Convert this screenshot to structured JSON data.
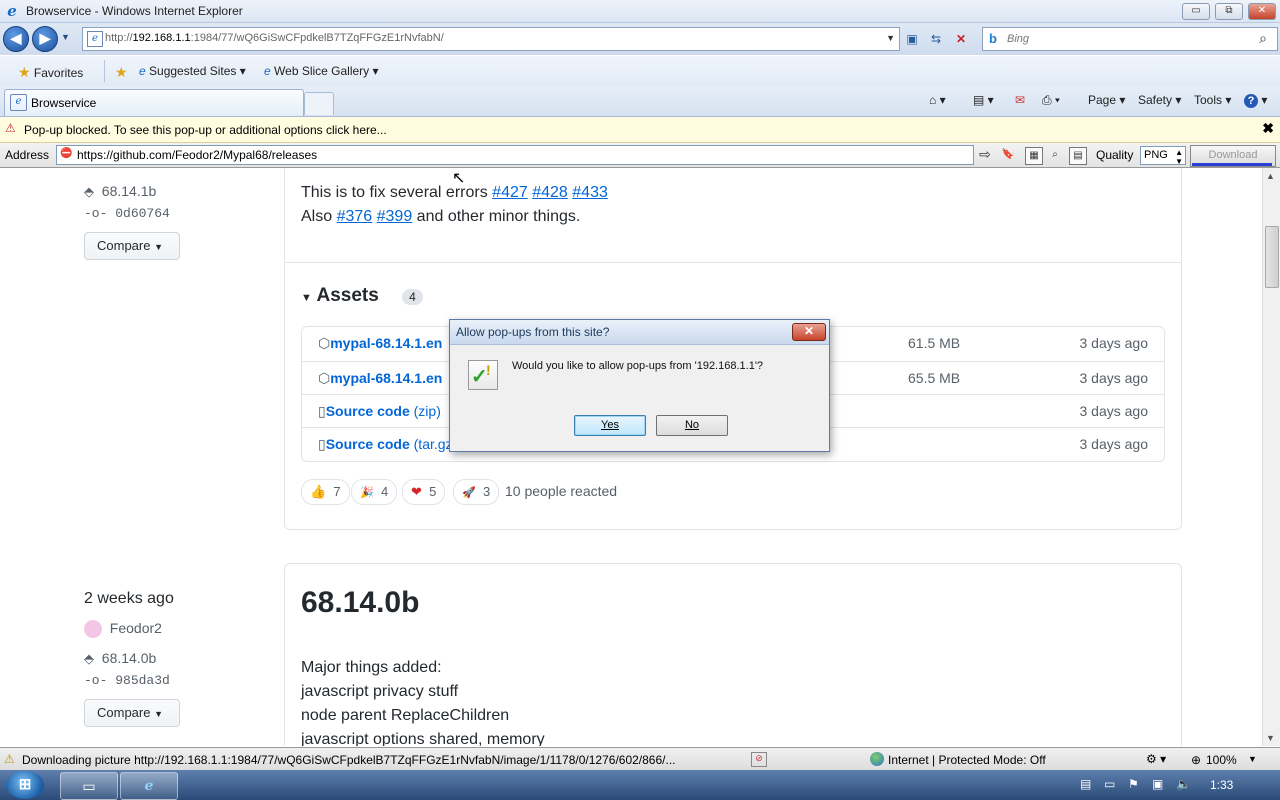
{
  "window": {
    "title": "Browservice - Windows Internet Explorer",
    "min_label": "▭",
    "max_label": "⧉",
    "close_label": "✕"
  },
  "nav": {
    "back_label": "◀",
    "forward_label": "▶",
    "url_prefix": "http://",
    "url_host": "192.168.1.1",
    "url_rest": ":1984/77/wQ6GiSwCFpdkelB7TZqFFGzE1rNvfabN/",
    "search_placeholder": "Bing"
  },
  "favorites": {
    "favorites_label": "Favorites",
    "suggested_label": "Suggested Sites",
    "slice_label": "Web Slice Gallery"
  },
  "tab": {
    "title": "Browservice"
  },
  "commands": {
    "page": "Page",
    "safety": "Safety",
    "tools": "Tools",
    "help": "?"
  },
  "infobar": {
    "text": "Pop-up blocked. To see this pop-up or additional options click here...",
    "close": "✖"
  },
  "address2": {
    "label": "Address",
    "url": "https://github.com/Feodor2/Mypal68/releases",
    "quality_label": "Quality",
    "quality_value": "PNG",
    "download_label": "Download"
  },
  "release1": {
    "tag": "68.14.1b",
    "commit": "0d60764",
    "compare_label": "Compare",
    "line1_prefix": "This is to fix several errors",
    "issues1": [
      "#427",
      "#428",
      "#433"
    ],
    "line2_prefix": "Also",
    "issues2": [
      "#376",
      "#399"
    ],
    "line2_suffix": "and other minor things.",
    "assets_label": "Assets",
    "assets_count": "4",
    "assets": [
      {
        "name": "mypal-68.14.1.en",
        "size": "61.5 MB",
        "date": "3 days ago"
      },
      {
        "name": "mypal-68.14.1.en",
        "size": "65.5 MB",
        "date": "3 days ago"
      },
      {
        "name": "Source code",
        "ext": "(zip)",
        "size": "",
        "date": "3 days ago"
      },
      {
        "name": "Source code",
        "ext": "(tar.gz)",
        "size": "",
        "date": "3 days ago"
      }
    ],
    "reactions": [
      {
        "emoji": "👍",
        "count": "7"
      },
      {
        "emoji": "🎉",
        "count": "4"
      },
      {
        "emoji": "❤",
        "count": "5"
      },
      {
        "emoji": "🚀",
        "count": "3"
      }
    ],
    "reacted_text": "10 people reacted"
  },
  "release2": {
    "date": "2 weeks ago",
    "author": "Feodor2",
    "tag": "68.14.0b",
    "commit": "985da3d",
    "compare_label": "Compare",
    "title": "68.14.0b",
    "lines": [
      "Major things added:",
      "javascript privacy stuff",
      "node parent ReplaceChildren",
      "javascript options shared, memory"
    ]
  },
  "dialog": {
    "title": "Allow pop-ups from this site?",
    "message": "Would you like to allow pop-ups from '192.168.1.1'?",
    "yes_label": "Yes",
    "no_label": "No"
  },
  "status": {
    "text": "Downloading picture http://192.168.1.1:1984/77/wQ6GiSwCFpdkelB7TZqFFGzE1rNvfabN/image/1/1178/0/1276/602/866/...",
    "zone": "Internet | Protected Mode: Off",
    "zoom": "100%"
  },
  "taskbar": {
    "clock": "1:33"
  }
}
